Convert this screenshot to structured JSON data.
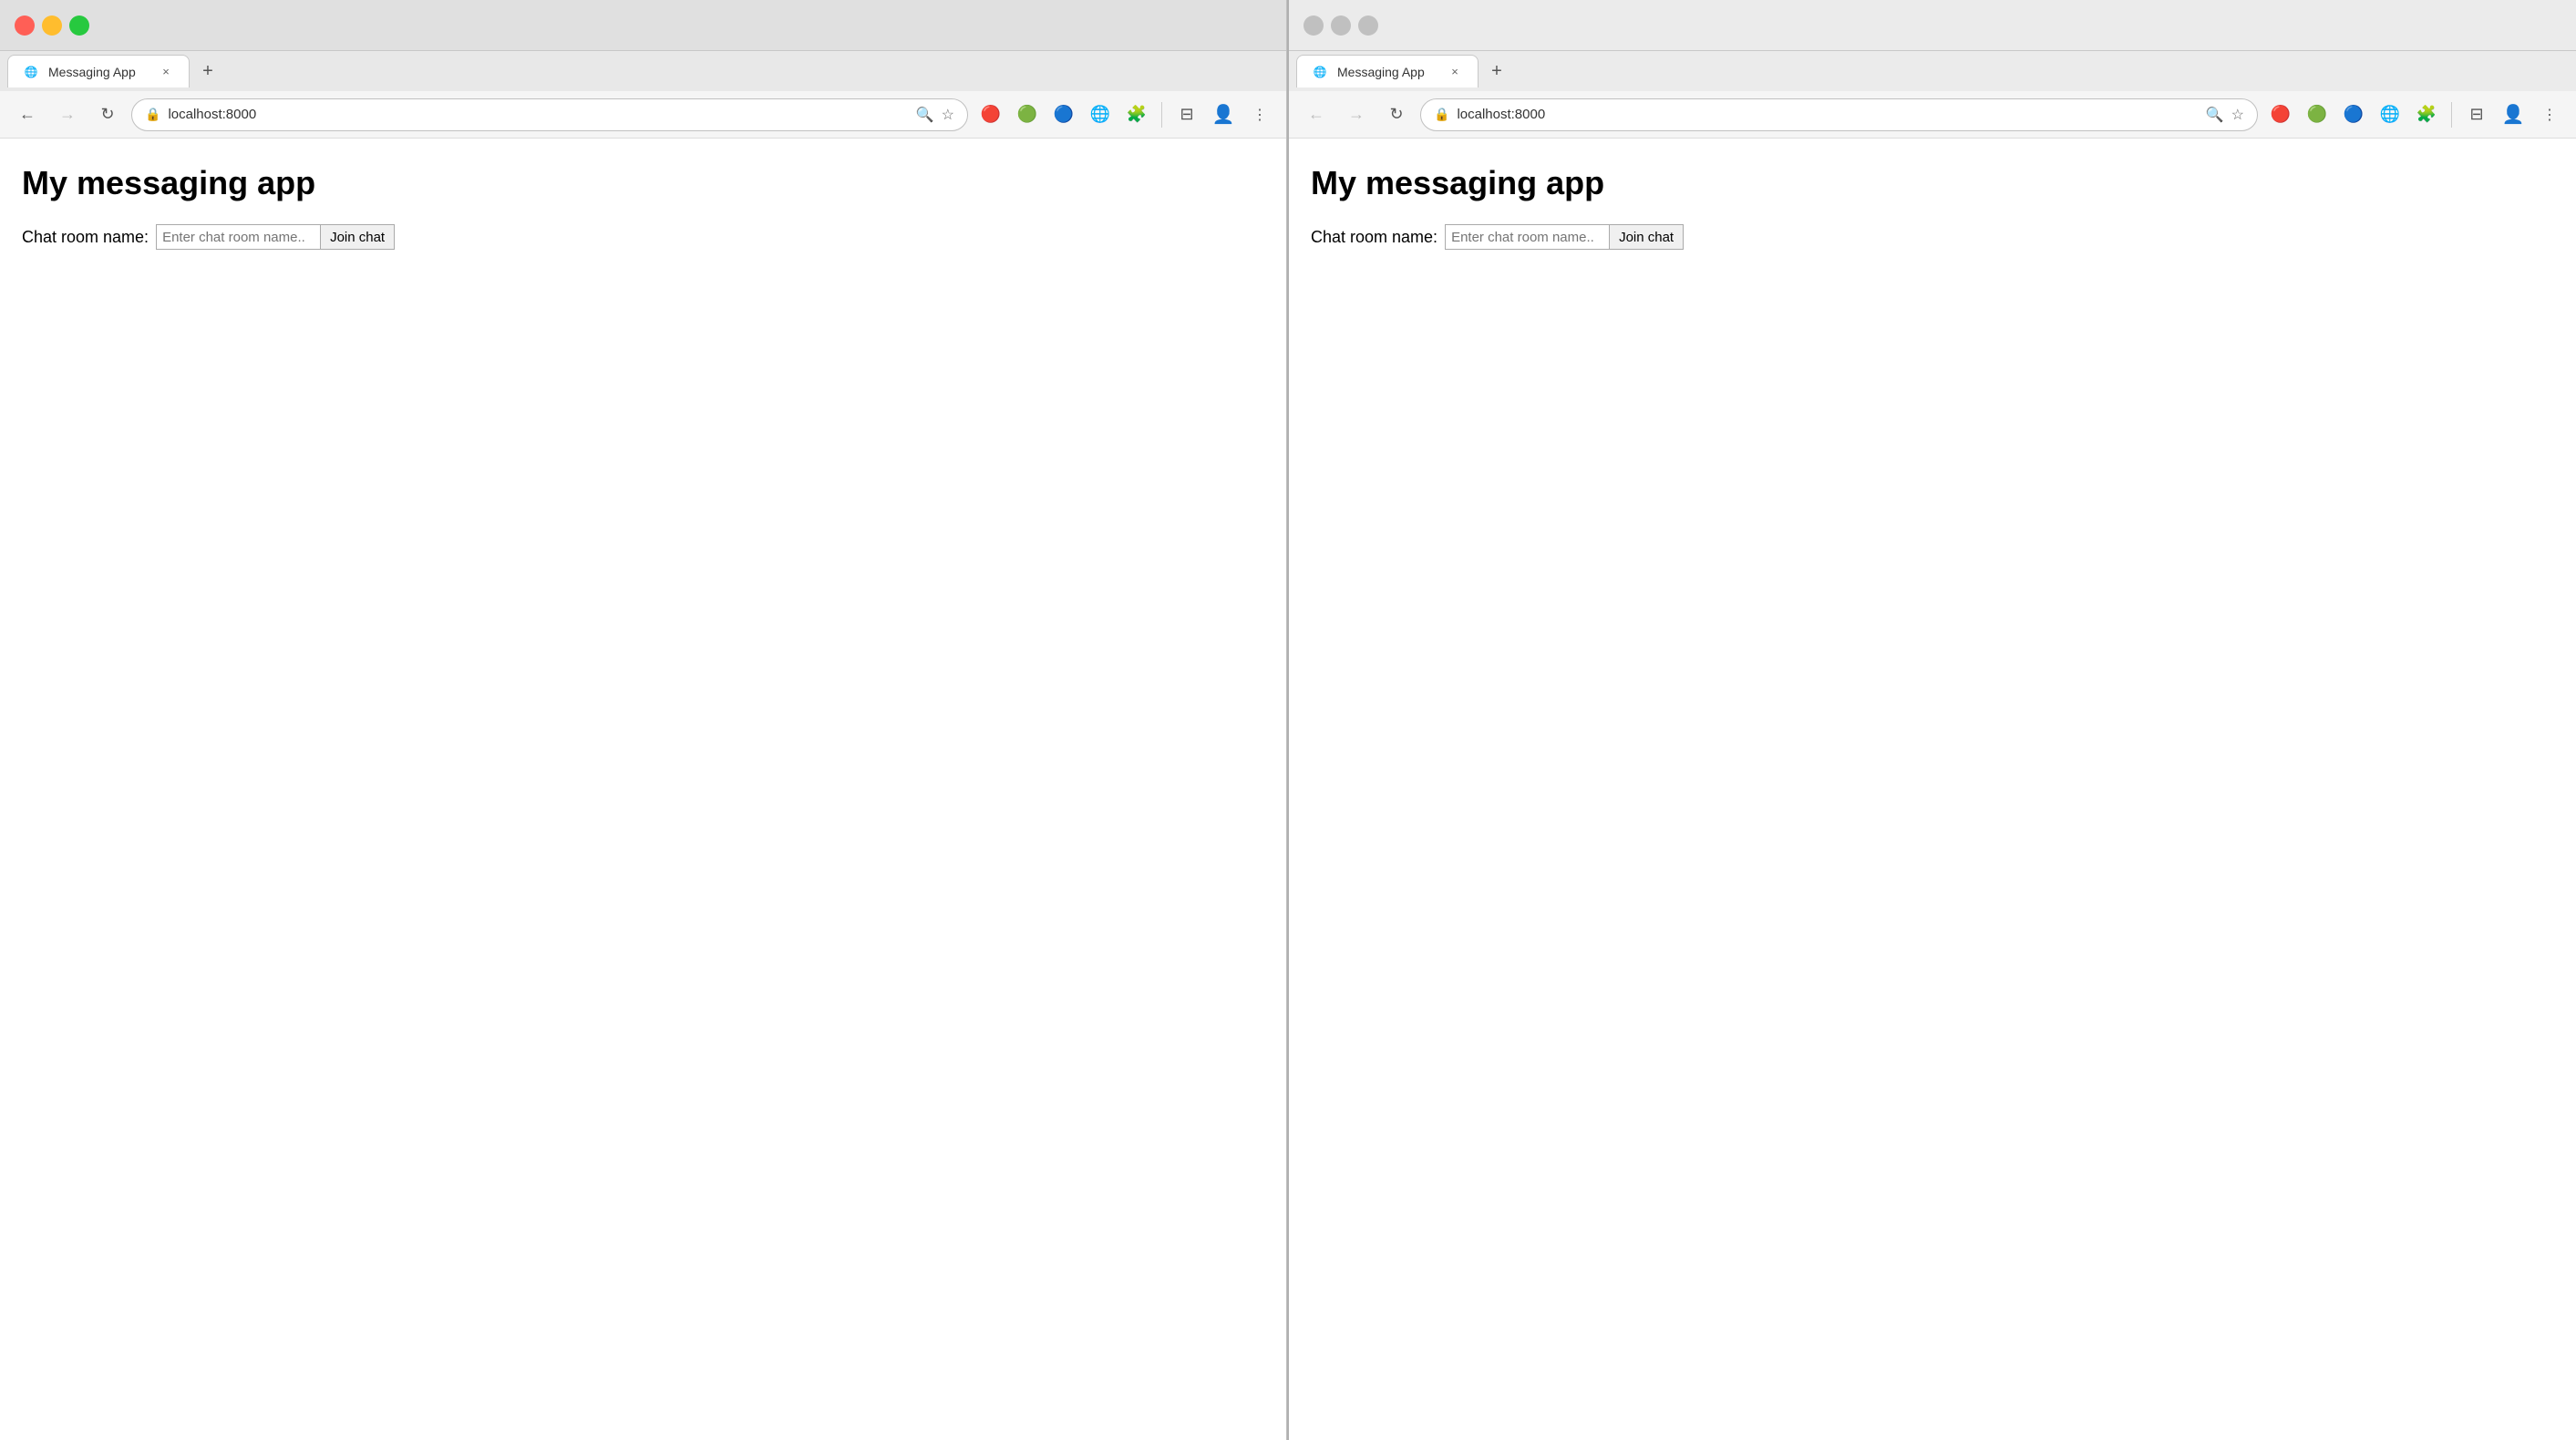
{
  "left_browser": {
    "tab": {
      "favicon": "🌐",
      "title": "Messaging App",
      "close_label": "×"
    },
    "new_tab_label": "+",
    "nav": {
      "back_label": "←",
      "forward_label": "→",
      "reload_label": "↻",
      "url": "localhost:8000",
      "search_icon": "🔍",
      "star_icon": "☆",
      "collapse_icon": "⊟",
      "avatar_icon": "👤",
      "menu_icon": "⋮"
    },
    "page": {
      "title": "My messaging app",
      "chat_room_label": "Chat room name:",
      "chat_room_placeholder": "Enter chat room name..",
      "join_button_label": "Join chat"
    }
  },
  "right_browser": {
    "tab": {
      "favicon": "🌐",
      "title": "Messaging App",
      "close_label": "×"
    },
    "new_tab_label": "+",
    "nav": {
      "back_label": "←",
      "forward_label": "→",
      "reload_label": "↻",
      "url": "localhost:8000",
      "search_icon": "🔍",
      "star_icon": "☆",
      "collapse_icon": "⊟",
      "avatar_icon": "👤",
      "menu_icon": "⋮"
    },
    "page": {
      "title": "My messaging app",
      "chat_room_label": "Chat room name:",
      "chat_room_placeholder": "Enter chat room name..",
      "join_button_label": "Join chat"
    }
  }
}
